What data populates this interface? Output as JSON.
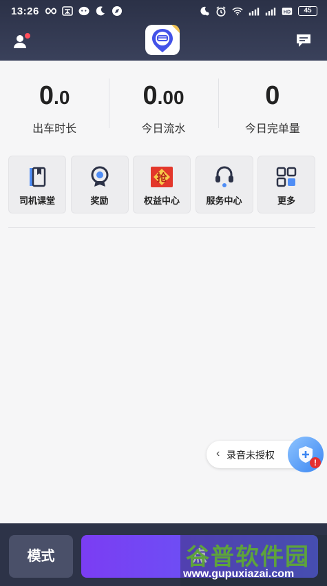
{
  "status_bar": {
    "time": "13:26",
    "battery": "45",
    "icons": [
      "infinity-icon",
      "wechat-icon",
      "moon-icon",
      "compass-icon",
      "dnd-icon",
      "alarm-icon",
      "wifi-icon",
      "signal-4g-icon",
      "signal-4g-icon",
      "hd-icon",
      "battery-icon"
    ]
  },
  "header": {
    "user_icon": "user-icon",
    "logo_icon": "driver-app-logo",
    "message_icon": "message-icon"
  },
  "stats": [
    {
      "value_main": "0",
      "value_small": ".0",
      "label": "出车时长"
    },
    {
      "value_main": "0",
      "value_small": ".00",
      "label": "今日流水"
    },
    {
      "value_main": "0",
      "value_small": "",
      "label": "今日完单量"
    }
  ],
  "shortcuts": [
    {
      "label": "司机课堂",
      "icon": "book-icon"
    },
    {
      "label": "奖励",
      "icon": "medal-icon"
    },
    {
      "label": "权益中心",
      "icon": "grab-badge-icon",
      "badge_text": "抢"
    },
    {
      "label": "服务中心",
      "icon": "headset-icon"
    },
    {
      "label": "更多",
      "icon": "grid-icon"
    }
  ],
  "recording": {
    "chevron": "‹",
    "label": "录音未授权",
    "warn": "!"
  },
  "bottom": {
    "mode_label": "模式",
    "go_label": "点"
  },
  "watermark": {
    "title": "谷普软件园",
    "url": "www.gupuxiazai.com"
  },
  "colors": {
    "header_bg": "#2b3147",
    "accent_purple": "#7b3df3",
    "accent_blue": "#3b86f2",
    "alert_red": "#e52f2f"
  }
}
